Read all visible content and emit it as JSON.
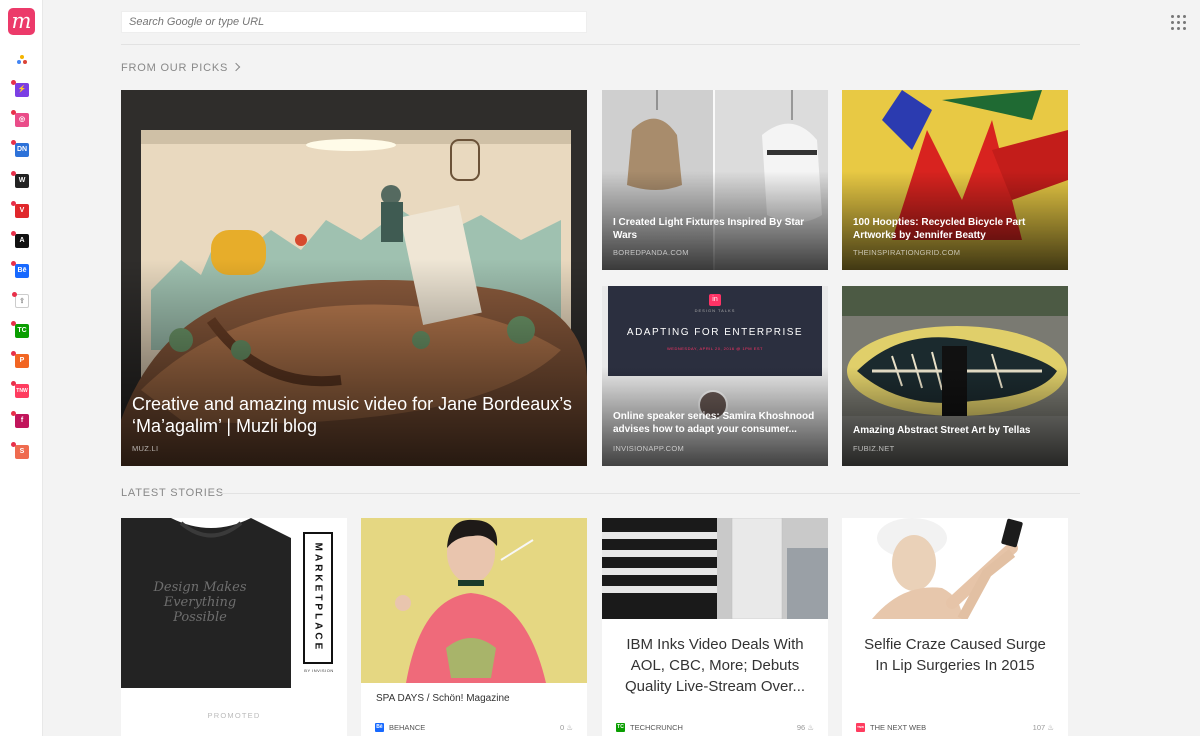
{
  "search": {
    "placeholder": "Search Google or type URL"
  },
  "logo": {
    "letter": "m"
  },
  "sidebar": {
    "sources": [
      {
        "name": "google",
        "glyph": "",
        "color": "#ffffff"
      },
      {
        "name": "producthunt",
        "glyph": "⚡",
        "color": "#7b3fe4"
      },
      {
        "name": "dribbble",
        "glyph": "◎",
        "color": "#ea4c89"
      },
      {
        "name": "designer-news",
        "glyph": "DN",
        "color": "#2d72d9"
      },
      {
        "name": "webdesigner-depot",
        "glyph": "W",
        "color": "#222222"
      },
      {
        "name": "vectips",
        "glyph": "V",
        "color": "#e0272b"
      },
      {
        "name": "abduzeedo",
        "glyph": "A",
        "color": "#111111"
      },
      {
        "name": "behance",
        "glyph": "Bē",
        "color": "#1769ff"
      },
      {
        "name": "share",
        "glyph": "⇪",
        "color": "#999999"
      },
      {
        "name": "techcrunch",
        "glyph": "TC",
        "color": "#0a9e01"
      },
      {
        "name": "product-p",
        "glyph": "P",
        "color": "#f26522"
      },
      {
        "name": "the-next-web",
        "glyph": "TNW",
        "color": "#ff3c5f"
      },
      {
        "name": "fubiz",
        "glyph": "f",
        "color": "#c1155b"
      },
      {
        "name": "smashing",
        "glyph": "S",
        "color": "#ef6b4f"
      }
    ]
  },
  "picks": {
    "title": "FROM OUR PICKS",
    "items": [
      {
        "title": "Creative and amazing music video for Jane Bordeaux’s ‘Ma’agalim’ | Muzli blog",
        "source": "MUZ.LI"
      },
      {
        "title": "I Created Light Fixtures Inspired By Star Wars",
        "source": "BOREDPANDA.COM"
      },
      {
        "title": "100 Hoopties: Recycled Bicycle Part Artworks by Jennifer Beatty",
        "source": "THEINSPIRATIONGRID.COM"
      },
      {
        "title": "Online speaker series: Samira Khoshnood advises how to adapt your consumer...",
        "source": "INVISIONAPP.COM",
        "banner_title": "ADAPTING FOR ENTERPRISE",
        "banner_date": "WEDNESDAY, APRIL 20, 2016 @ 1PM EST",
        "banner_kicker": "DESIGN TALKS",
        "banner_logo": "in"
      },
      {
        "title": "Amazing Abstract Street Art by Tellas",
        "source": "FUBIZ.NET"
      }
    ]
  },
  "latest": {
    "title": "LATEST STORIES",
    "cards": [
      {
        "promoted": "PROMOTED",
        "marketplace": "MARKETPLACE",
        "by": "BY INVISION",
        "shirt_text": "Design Makes Everything Possible"
      },
      {
        "headline": "SPA DAYS / Schön! Magazine",
        "source": "BEHANCE",
        "count": "0",
        "color": "#1769ff",
        "glyph": "Bē"
      },
      {
        "headline": "IBM Inks Video Deals With AOL, CBC, More; Debuts Quality Live-Stream Over...",
        "source": "TECHCRUNCH",
        "count": "96",
        "color": "#0a9e01",
        "glyph": "TC"
      },
      {
        "headline": "Selfie Craze Caused Surge In Lip Surgeries In 2015",
        "source": "THE NEXT WEB",
        "count": "107",
        "color": "#ff3c5f",
        "glyph": "TNW"
      }
    ]
  }
}
